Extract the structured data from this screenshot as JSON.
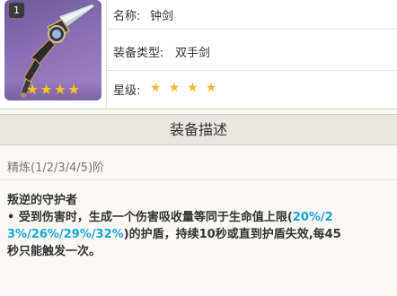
{
  "item": {
    "rank_badge": "1",
    "thumb_stars": [
      "★",
      "★",
      "★",
      "★"
    ],
    "name_label": "名称:",
    "name_value": "钟剑",
    "type_label": "装备类型:",
    "type_value": "双手剑",
    "rarity_label": "星级:",
    "rarity_stars": [
      "★",
      "★",
      "★",
      "★"
    ]
  },
  "section": {
    "title": "装备描述"
  },
  "refine": {
    "text": "精炼(1/2/3/4/5)阶"
  },
  "effect": {
    "title": "叛逆的守护者",
    "bullet": "•",
    "line1_pre": " 受到伤害时，生成一个伤害吸收量等同于生命值上限(",
    "line1_hl": "20%/2",
    "line2_hl": "3%/26%/29%/32%",
    "line2_post": ")的护盾，持续10秒或直到护盾失效,每45",
    "line3": "秒只能触发一次。"
  },
  "colors": {
    "highlight": "#1aa3d9",
    "star": "#f4b83a",
    "section_bg": "#ece7de"
  }
}
